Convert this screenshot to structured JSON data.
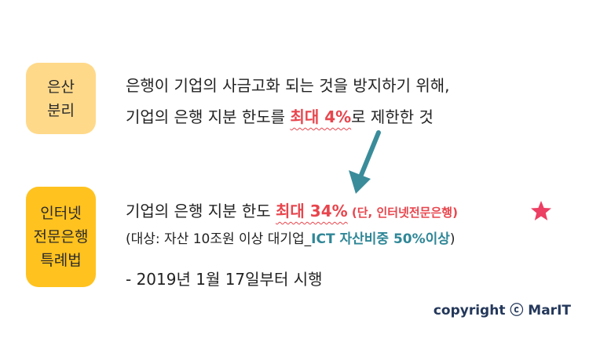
{
  "box1": {
    "line1": "은산",
    "line2": "분리",
    "color": "#ffd98a"
  },
  "box2": {
    "line1": "인터넷",
    "line2": "전문은행",
    "line3": "특례법",
    "color": "#ffc21f"
  },
  "top_text": {
    "line1": "은행이 기업의 사금고화 되는 것을 방지하기 위해,",
    "line2_prefix": "기업의 은행 지분 한도를 ",
    "line2_highlight": "최대 4%",
    "line2_suffix": "로 제한한 것"
  },
  "bottom_text": {
    "line1_prefix": "기업의 은행 지분 한도 ",
    "line1_highlight": "최대 34%",
    "line1_note": " (단, 인터넷전문은행)",
    "line2_prefix": "(대상: 자산 10조원 이상 대기업_",
    "line2_highlight": "ICT 자산비중 50%이상",
    "line2_suffix": ")",
    "line3": "- 2019년 1월 17일부터 시행"
  },
  "copyright": "copyright ⓒ MarIT",
  "icons": {
    "arrow": "down-arrow-icon",
    "star": "star-icon"
  },
  "colors": {
    "accent_red": "#e8454d",
    "accent_teal": "#2f8797",
    "arrow": "#3a8c9a",
    "star": "#ec3f63"
  }
}
